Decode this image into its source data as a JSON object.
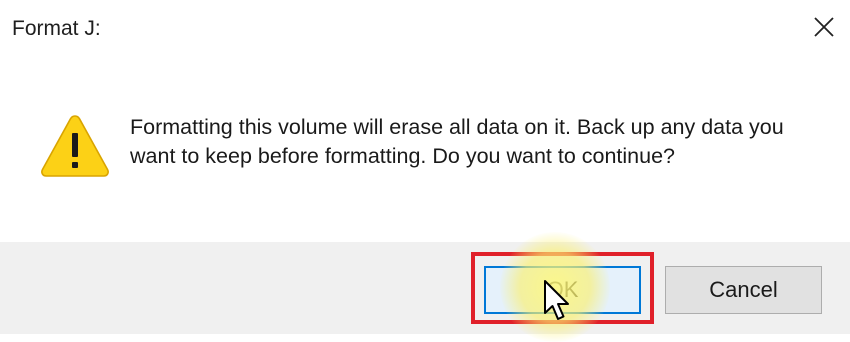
{
  "dialog": {
    "title": "Format J:",
    "message": "Formatting this volume will erase all data on it. Back up any data you want to keep before formatting. Do you want to continue?",
    "ok_label": "OK",
    "cancel_label": "Cancel"
  },
  "icons": {
    "warning": "warning-triangle-icon",
    "close": "close-icon",
    "cursor": "mouse-pointer-icon"
  },
  "colors": {
    "warning_fill": "#fcd116",
    "ok_border": "#0078d7",
    "highlight": "#e0202a",
    "footer_bg": "#f0f0f0"
  }
}
